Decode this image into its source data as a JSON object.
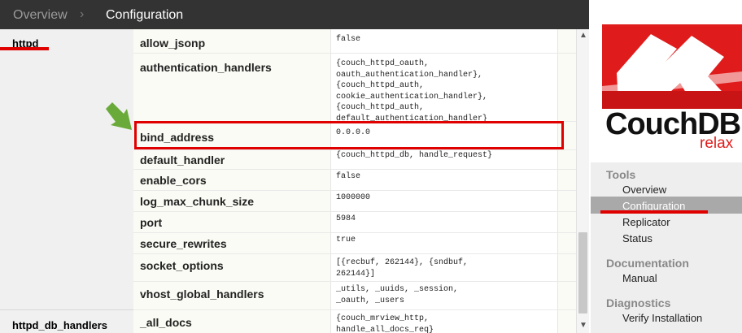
{
  "breadcrumb": {
    "root": "Overview",
    "current": "Configuration"
  },
  "sections": [
    {
      "label": "httpd"
    },
    {
      "label": "httpd_db_handlers"
    }
  ],
  "options": [
    {
      "key": "allow_jsonp",
      "value": "false"
    },
    {
      "key": "authentication_handlers",
      "value": "{couch_httpd_oauth,\noauth_authentication_handler},\n{couch_httpd_auth,\ncookie_authentication_handler},\n{couch_httpd_auth,\ndefault_authentication_handler}"
    },
    {
      "key": "bind_address",
      "value": "0.0.0.0"
    },
    {
      "key": "default_handler",
      "value": "{couch_httpd_db, handle_request}"
    },
    {
      "key": "enable_cors",
      "value": "false"
    },
    {
      "key": "log_max_chunk_size",
      "value": "1000000"
    },
    {
      "key": "port",
      "value": "5984"
    },
    {
      "key": "secure_rewrites",
      "value": "true"
    },
    {
      "key": "socket_options",
      "value": "[{recbuf, 262144}, {sndbuf,\n262144}]"
    },
    {
      "key": "vhost_global_handlers",
      "value": "_utils, _uuids, _session,\n_oauth, _users"
    },
    {
      "key": "_all_docs",
      "value": "{couch_mrview_http,\nhandle_all_docs_req}"
    }
  ],
  "scrollbar": {
    "up_icon": "▲",
    "down_icon": "▼"
  },
  "brand": {
    "name": "CouchDB",
    "tagline": "relax"
  },
  "sidebar": {
    "tools_title": "Tools",
    "tools": [
      {
        "label": "Overview"
      },
      {
        "label": "Configuration"
      },
      {
        "label": "Replicator"
      },
      {
        "label": "Status"
      }
    ],
    "docs_title": "Documentation",
    "docs": [
      {
        "label": "Manual"
      }
    ],
    "diag_title": "Diagnostics",
    "diag": [
      {
        "label": "Verify Installation"
      }
    ]
  },
  "colors": {
    "accent": "#e00000",
    "arrow": "#6aaa3a",
    "brand_red": "#e01b1b",
    "topbar": "#333333"
  }
}
